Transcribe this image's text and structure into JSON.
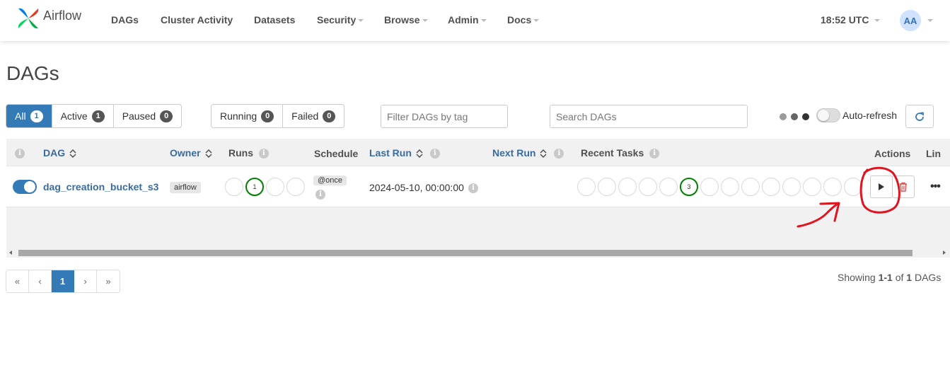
{
  "navbar": {
    "brand": "Airflow",
    "items": [
      {
        "label": "DAGs",
        "dropdown": false
      },
      {
        "label": "Cluster Activity",
        "dropdown": false
      },
      {
        "label": "Datasets",
        "dropdown": false
      },
      {
        "label": "Security",
        "dropdown": true
      },
      {
        "label": "Browse",
        "dropdown": true
      },
      {
        "label": "Admin",
        "dropdown": true
      },
      {
        "label": "Docs",
        "dropdown": true
      }
    ],
    "time": "18:52 UTC",
    "avatar_initials": "AA"
  },
  "page": {
    "title": "DAGs"
  },
  "filters": {
    "status": [
      {
        "label": "All",
        "count": "1",
        "active": true
      },
      {
        "label": "Active",
        "count": "1",
        "active": false
      },
      {
        "label": "Paused",
        "count": "0",
        "active": false
      }
    ],
    "runs": [
      {
        "label": "Running",
        "count": "0"
      },
      {
        "label": "Failed",
        "count": "0"
      }
    ],
    "tag_placeholder": "Filter DAGs by tag",
    "search_placeholder": "Search DAGs",
    "auto_refresh_label": "Auto-refresh",
    "auto_refresh_enabled": false
  },
  "table": {
    "headers": {
      "dag": "DAG",
      "owner": "Owner",
      "runs": "Runs",
      "schedule": "Schedule",
      "last_run": "Last Run",
      "next_run": "Next Run",
      "recent_tasks": "Recent Tasks",
      "actions": "Actions",
      "links": "Lin"
    },
    "rows": [
      {
        "enabled": true,
        "dag_id": "dag_creation_bucket_s3",
        "owner": "airflow",
        "runs": [
          "",
          "1",
          "",
          ""
        ],
        "schedule": "@once",
        "last_run": "2024-05-10, 00:00:00",
        "next_run": "",
        "recent_tasks_success_count": "3"
      }
    ]
  },
  "pagination": {
    "first": "«",
    "prev": "‹",
    "current": "1",
    "next": "›",
    "last": "»"
  },
  "footer": {
    "showing_prefix": "Showing",
    "showing_range": "1-1",
    "showing_of": "of",
    "showing_total": "1",
    "showing_suffix": "DAGs"
  },
  "colors": {
    "primary": "#337ab7",
    "success": "#008000",
    "annotation": "#e0141e"
  }
}
